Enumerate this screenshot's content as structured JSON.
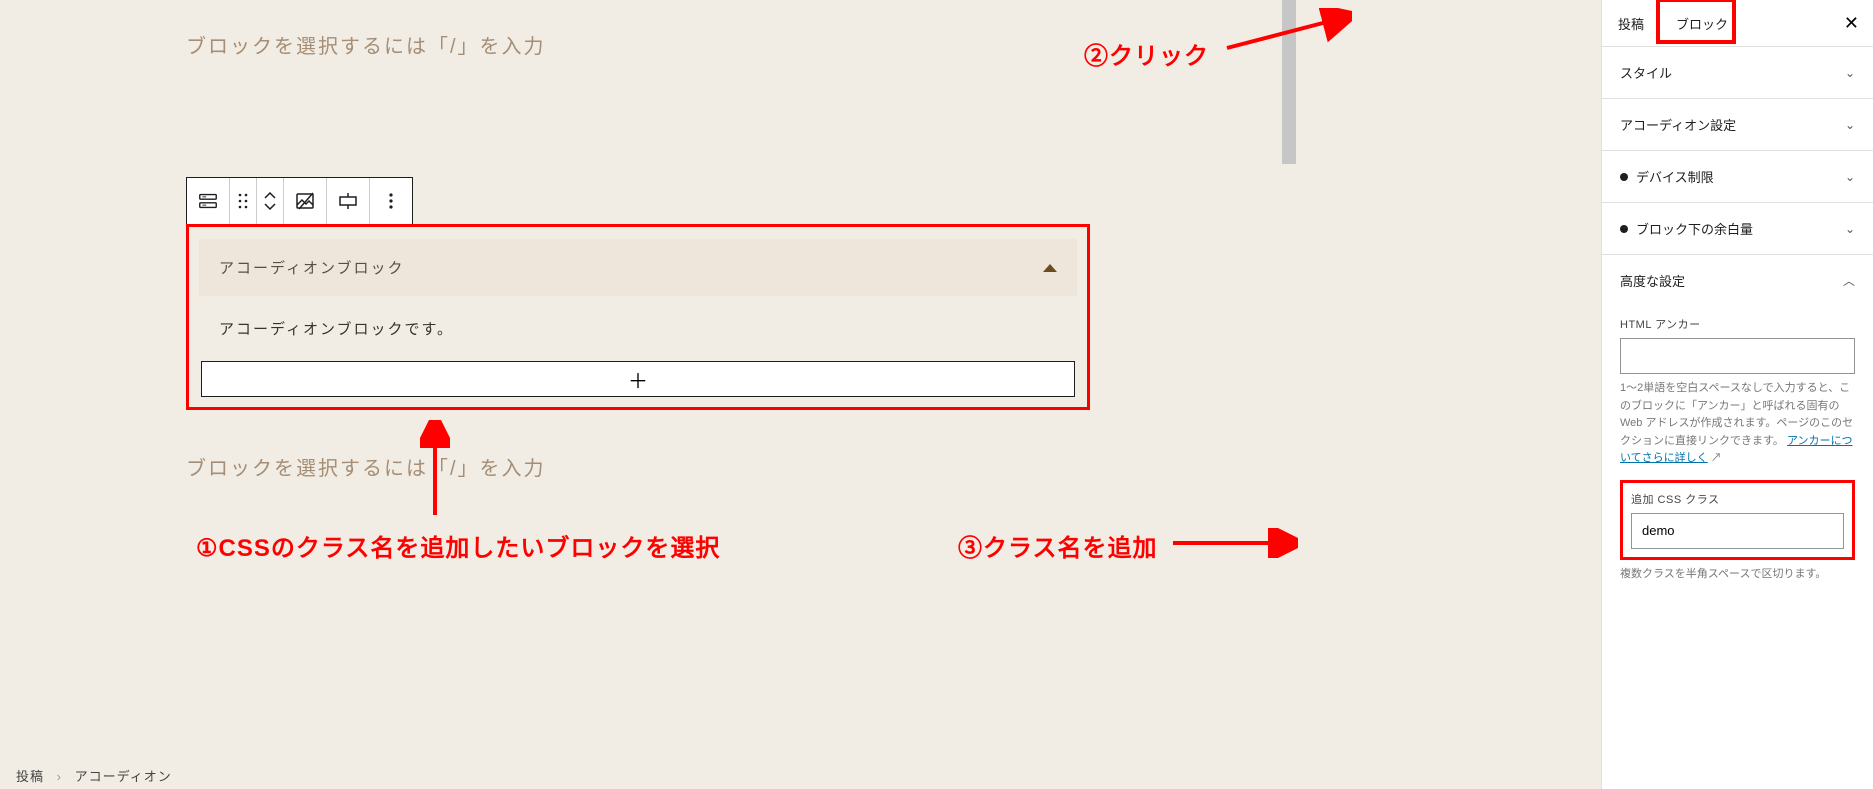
{
  "editor": {
    "placeholder": "ブロックを選択するには「/」を入力",
    "placeholder2": "ブロックを選択するには「/」を入力",
    "accordion_title": "アコーディオンブロック",
    "accordion_content": "アコーディオンブロックです。",
    "add_icon": "＋"
  },
  "breadcrumb": {
    "root": "投稿",
    "sep": "›",
    "current": "アコーディオン"
  },
  "sidebar": {
    "tabs": {
      "post": "投稿",
      "block": "ブロック"
    },
    "panels": {
      "style": "スタイル",
      "accordion": "アコーディオン設定",
      "device": "デバイス制限",
      "margin": "ブロック下の余白量",
      "advanced": "高度な設定"
    },
    "anchor_label": "HTML アンカー",
    "anchor_help": "1〜2単語を空白スペースなしで入力すると、このブロックに「アンカー」と呼ばれる固有の Web アドレスが作成されます。ページのこのセクションに直接リンクできます。",
    "anchor_link": "アンカーについてさらに詳しく",
    "anchor_link_suffix": " ↗",
    "css_label": "追加 CSS クラス",
    "css_value": "demo",
    "css_help": "複数クラスを半角スペースで区切ります。"
  },
  "annotations": {
    "a1": "①CSSのクラス名を追加したいブロックを選択",
    "a2": "②クリック",
    "a3": "③クラス名を追加"
  }
}
